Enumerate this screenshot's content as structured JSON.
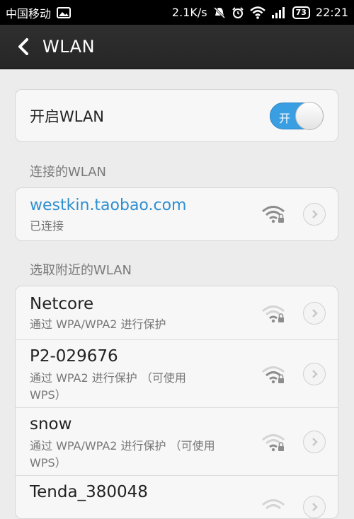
{
  "status": {
    "carrier": "中国移动",
    "speed": "2.1K/s",
    "battery": "73",
    "time": "22:21"
  },
  "header": {
    "title": "WLAN"
  },
  "toggle": {
    "label": "开启WLAN",
    "state_text": "开",
    "on": true
  },
  "sections": {
    "connected_header": "连接的WLAN",
    "nearby_header": "选取附近的WLAN"
  },
  "connected": {
    "name": "westkin.taobao.com",
    "status": "已连接"
  },
  "networks": [
    {
      "name": "Netcore",
      "security_line1": "通过 WPA/WPA2 进行保护",
      "security_line2": ""
    },
    {
      "name": "P2-029676",
      "security_line1": "通过 WPA2 进行保护 （可使用",
      "security_line2": "WPS）"
    },
    {
      "name": "snow",
      "security_line1": "通过 WPA/WPA2 进行保护 （可使用",
      "security_line2": "WPS）"
    },
    {
      "name": "Tenda_380048",
      "security_line1": "",
      "security_line2": ""
    }
  ],
  "colors": {
    "accent": "#3a9ee3",
    "connected_text": "#2f8fd0"
  }
}
